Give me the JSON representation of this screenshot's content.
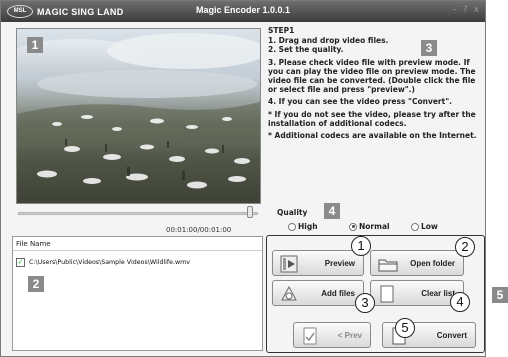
{
  "app": {
    "logo_badge": "MSL",
    "logo_text": "MAGIC SING LAND",
    "title": "Magic Encoder 1.0.0.1",
    "minimize": "–",
    "maximize": "?",
    "close": "x"
  },
  "callouts": [
    "1",
    "2",
    "3",
    "4",
    "5"
  ],
  "markers": [
    "1",
    "2",
    "3",
    "4",
    "5"
  ],
  "player": {
    "time": "00:01:00/00:01:00",
    "progress": 1.0
  },
  "filelist": {
    "header": "File Name",
    "items": [
      {
        "checked": true,
        "path": "C:\\Users\\Public\\Videos\\Sample Videos\\Wildlife.wmv"
      }
    ]
  },
  "instructions": {
    "step": "STEP1",
    "lines": [
      "1. Drag and drop video files.",
      "2. Set the quality.",
      "3. Please check video file with preview mode. If you can play the video file on preview mode. The video file can be converted. (Double click the file or select file and press \"preview\".)",
      "4. If you can see the video press \"Convert\".",
      "* If you do not see the video, please try after the installation of additional codecs.",
      "* Additional codecs are available on the Internet."
    ]
  },
  "quality": {
    "label": "Quality",
    "options": [
      "High",
      "Normal",
      "Low"
    ],
    "selected": "Normal"
  },
  "buttons": {
    "preview": "Preview",
    "open_folder": "Open folder",
    "add_files": "Add files",
    "clear_list": "Clear list",
    "prev": "< Prev",
    "convert": "Convert"
  },
  "icons": {
    "preview": "film-play-icon",
    "open_folder": "folder-icon",
    "add_files": "add-file-icon",
    "clear_list": "blank-page-icon",
    "prev": "check-page-icon",
    "convert": "convert-page-icon"
  }
}
